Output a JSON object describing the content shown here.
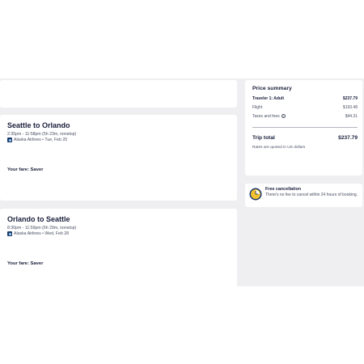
{
  "flights": [
    {
      "route": "Seattle to Orlando",
      "time": "2:35pm - 11:58pm (5h 23m, nonstop)",
      "airline": "Alaska Airlines • Tue, Feb 20",
      "fare": "Your fare: Saver"
    },
    {
      "route": "Orlando to Seattle",
      "time": "8:30pm - 11:59pm (6h 29m, nonstop)",
      "airline": "Alaska Airlines • Wed, Feb 28",
      "fare": "Your fare: Saver"
    }
  ],
  "price_summary": {
    "title": "Price summary",
    "traveler_label": "Traveler 1: Adult",
    "traveler_amount": "$237.79",
    "flight_label": "Flight",
    "flight_amount": "$193.48",
    "taxes_label": "Taxes and fees",
    "taxes_amount": "$44.31",
    "info_glyph": "i",
    "total_label": "Trip total",
    "total_amount": "$237.79",
    "note": "Rates are quoted in US dollars"
  },
  "cancellation": {
    "title": "Free cancellation",
    "text": "There's no fee to cancel within 24 hours of booking."
  },
  "colors": {
    "page_background": "#efeff1",
    "card": "#ffffff",
    "text_primary": "#191e3b",
    "text_secondary": "#4a4f63",
    "airline_logo": "#1a3a6e",
    "clock_accent": "#f2c230"
  },
  "icons": {
    "airline": "alaska-airlines-logo-icon",
    "info": "info-icon",
    "clock": "clock-icon"
  }
}
